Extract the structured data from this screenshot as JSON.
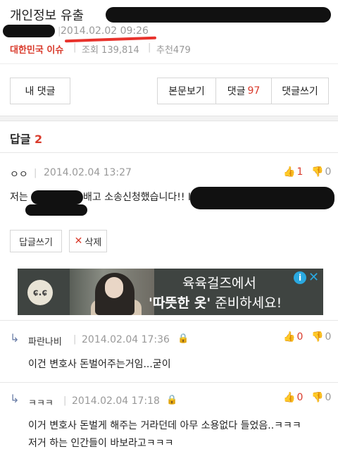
{
  "post": {
    "title": "개인정보 유출",
    "date": "2014.02.02 09:26",
    "category": "대한민국 이슈",
    "views": "조회 139,814",
    "recommends": "추천479",
    "separator": "|"
  },
  "buttons": {
    "my_comment": "내 댓글",
    "view_body": "본문보기",
    "comment_label": "댓글",
    "comment_count": "97",
    "write_comment": "댓글쓰기"
  },
  "replies": {
    "label": "답글",
    "count": "2"
  },
  "comment": {
    "author": "ㅇㅇ",
    "date": "2014.02.04 13:27",
    "text_start": "저는",
    "text_mid": "배고 소송신청했습니다!! I",
    "up": "1",
    "down": "0",
    "reply_btn": "답글쓰기",
    "delete_btn": "삭제"
  },
  "ad": {
    "logo": "ɕ.ɕ",
    "line1": "육육걸즈에서",
    "line2_quote": "'따뜻한 옷'",
    "line2_rest": " 준비하세요!",
    "info": "i",
    "close": "✕"
  },
  "sub_replies": [
    {
      "author": "파란나비",
      "date": "2014.02.04 17:36",
      "text": "이건 변호사 돈벌어주는거임...굳이",
      "up": "0",
      "down": "0"
    },
    {
      "author": "ㅋㅋㅋ",
      "date": "2014.02.04 17:18",
      "text1": "이거 변호사 돈벌게 해주는 거라던데 아무 소용없다 들었음..ㅋㅋㅋ",
      "text2": "저거 하는 인간들이 바보라고ㅋㅋㅋ",
      "up": "0",
      "down": "0"
    }
  ],
  "colors": {
    "accent_red": "#d93a2b",
    "ad_info_blue": "#2aa8e0"
  }
}
